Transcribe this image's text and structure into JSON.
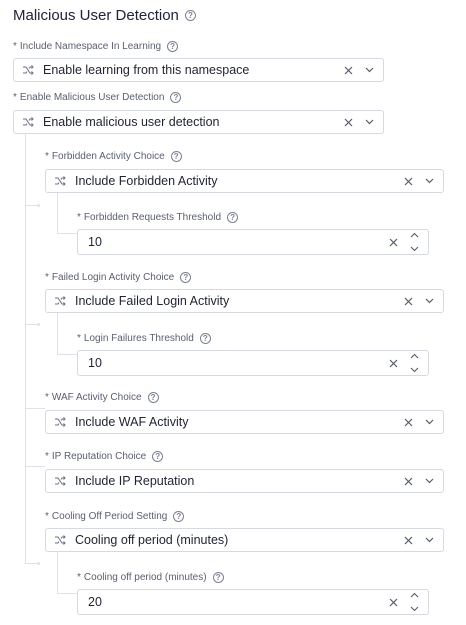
{
  "title": "Malicious User Detection",
  "fields": {
    "namespace_learning": {
      "label": "Include Namespace In Learning",
      "value": "Enable learning from this namespace"
    },
    "malicious_detection": {
      "label": "Enable Malicious User Detection",
      "value": "Enable malicious user detection"
    },
    "forbidden_choice": {
      "label": "Forbidden Activity Choice",
      "value": "Include Forbidden Activity"
    },
    "forbidden_threshold": {
      "label": "Forbidden Requests Threshold",
      "value": "10"
    },
    "failed_login_choice": {
      "label": "Failed Login Activity Choice",
      "value": "Include Failed Login Activity"
    },
    "login_threshold": {
      "label": "Login Failures Threshold",
      "value": "10"
    },
    "waf_choice": {
      "label": "WAF Activity Choice",
      "value": "Include WAF Activity"
    },
    "ip_reputation": {
      "label": "IP Reputation Choice",
      "value": "Include IP Reputation"
    },
    "cooling_setting": {
      "label": "Cooling Off Period Setting",
      "value": "Cooling off period (minutes)"
    },
    "cooling_period": {
      "label": "Cooling off period (minutes)",
      "value": "20"
    }
  },
  "required_marker": "*",
  "help_glyph": "?",
  "icons": {
    "select": "shuffle-icon",
    "clear": "close-icon",
    "dropdown": "chevron-down-icon",
    "help": "help-circle-icon",
    "stepper_up": "chevron-up-icon",
    "stepper_down": "chevron-down-icon"
  },
  "colors": {
    "border": "#d6d9e0",
    "tree_line": "#dfe2e8",
    "text": "#1f2330",
    "label": "#5a5f6e"
  }
}
